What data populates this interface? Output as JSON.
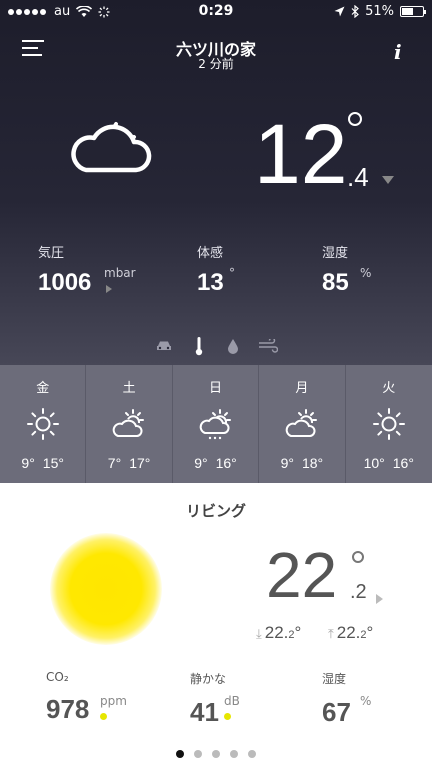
{
  "status_bar": {
    "carrier": "au",
    "time": "0:29",
    "battery": "51%"
  },
  "header": {
    "title": "六ツ川の家",
    "subtitle": "2 分前"
  },
  "outdoor": {
    "icon": "cloud-night-icon",
    "temperature_int": "12",
    "temperature_dec": ".4",
    "trend": "down",
    "pressure": {
      "label": "気圧",
      "value": "1006",
      "unit": "mbar"
    },
    "feels_like": {
      "label": "体感",
      "value": "13",
      "unit": "°"
    },
    "humidity": {
      "label": "湿度",
      "value": "85",
      "unit": "%"
    }
  },
  "module_icons": [
    "car-icon",
    "thermometer-icon",
    "drop-icon",
    "wind-icon"
  ],
  "forecast": [
    {
      "day": "金",
      "icon": "sun-icon",
      "low": "9°",
      "high": "15°"
    },
    {
      "day": "土",
      "icon": "sun-cloud-icon",
      "low": "7°",
      "high": "17°"
    },
    {
      "day": "日",
      "icon": "sun-cloud-rain-icon",
      "low": "9°",
      "high": "16°"
    },
    {
      "day": "月",
      "icon": "sun-cloud-icon",
      "low": "9°",
      "high": "18°"
    },
    {
      "day": "火",
      "icon": "sun-icon",
      "low": "10°",
      "high": "16°"
    }
  ],
  "indoor": {
    "room": "リビング",
    "temperature_int": "22",
    "temperature_dec": ".2",
    "min_int": "22.",
    "min_dec": "2",
    "max_int": "22.",
    "max_dec": "2",
    "co2": {
      "label": "CO₂",
      "value": "978",
      "unit": "ppm"
    },
    "noise": {
      "label": "静かな",
      "value": "41",
      "unit": "dB"
    },
    "humidity": {
      "label": "湿度",
      "value": "67",
      "unit": "%"
    },
    "indicator_color": "#e6e600"
  },
  "pager": {
    "count": 5,
    "active": 0
  }
}
